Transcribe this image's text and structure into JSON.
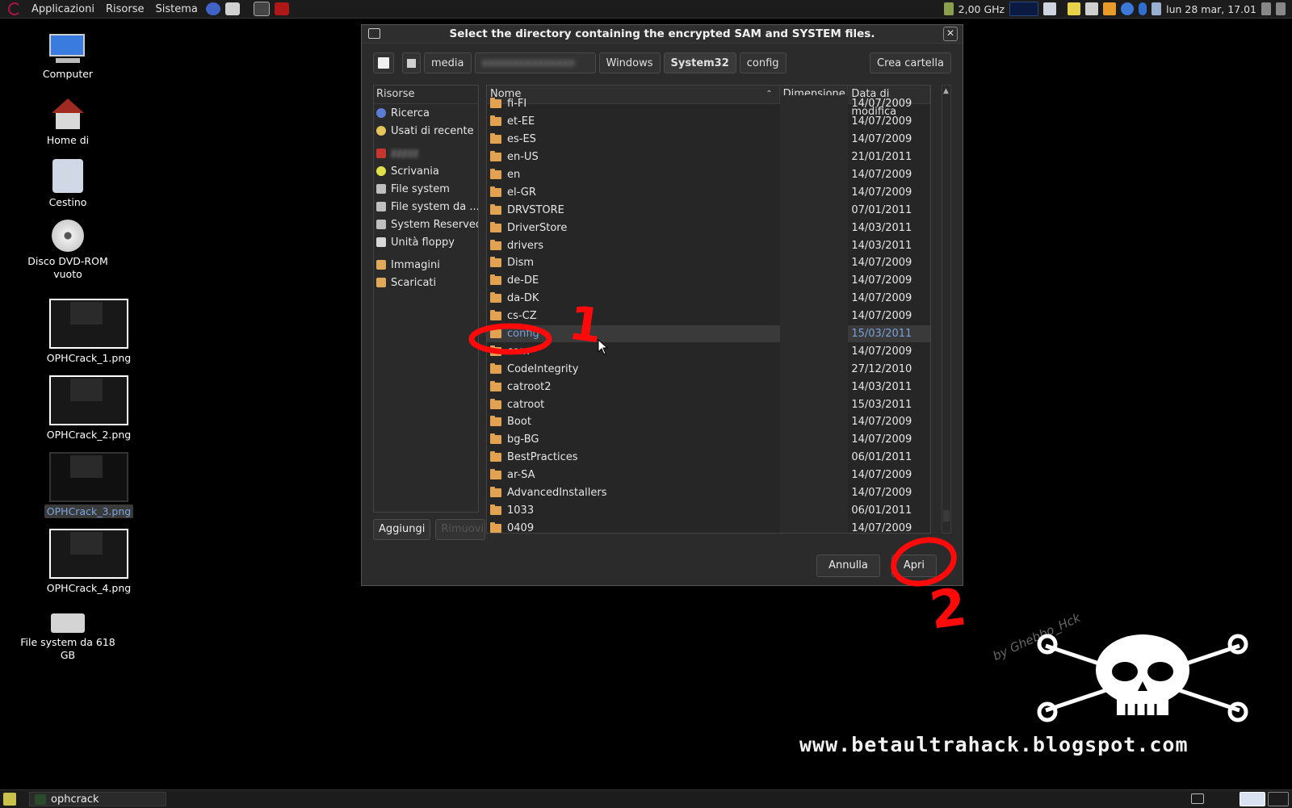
{
  "topbar": {
    "menus": [
      "Applicazioni",
      "Risorse",
      "Sistema"
    ],
    "cpu": "2,00 GHz",
    "clock": "lun 28 mar, 17.01"
  },
  "desktop": {
    "icons": [
      {
        "label": "Computer"
      },
      {
        "label": "Home di"
      },
      {
        "label": "Cestino"
      },
      {
        "label": "Disco DVD-ROM vuoto"
      },
      {
        "label": "OPHCrack_1.png"
      },
      {
        "label": "OPHCrack_2.png"
      },
      {
        "label": "OPHCrack_3.png"
      },
      {
        "label": "OPHCrack_4.png"
      },
      {
        "label": "File system da 618 GB"
      }
    ]
  },
  "dialog": {
    "title": "Select the directory containing the encrypted SAM and SYSTEM files.",
    "path": [
      "media",
      "Windows",
      "System32",
      "config"
    ],
    "create_folder": "Crea cartella",
    "places_header": "Risorse",
    "places": [
      "Ricerca",
      "Usati di recente",
      "Scrivania",
      "File system",
      "File system da ...",
      "System Reserved",
      "Unità floppy",
      "Immagini",
      "Scaricati"
    ],
    "add": "Aggiungi",
    "remove": "Rimuovi",
    "columns": {
      "name": "Nome",
      "size": "Dimensione",
      "date": "Data di modifica"
    },
    "files": [
      {
        "name": "fi-FI",
        "date": "14/07/2009"
      },
      {
        "name": "et-EE",
        "date": "14/07/2009"
      },
      {
        "name": "es-ES",
        "date": "14/07/2009"
      },
      {
        "name": "en-US",
        "date": "21/01/2011"
      },
      {
        "name": "en",
        "date": "14/07/2009"
      },
      {
        "name": "el-GR",
        "date": "14/07/2009"
      },
      {
        "name": "DRVSTORE",
        "date": "07/01/2011"
      },
      {
        "name": "DriverStore",
        "date": "14/03/2011"
      },
      {
        "name": "drivers",
        "date": "14/03/2011"
      },
      {
        "name": "Dism",
        "date": "14/07/2009"
      },
      {
        "name": "de-DE",
        "date": "14/07/2009"
      },
      {
        "name": "da-DK",
        "date": "14/07/2009"
      },
      {
        "name": "cs-CZ",
        "date": "14/07/2009"
      },
      {
        "name": "config",
        "date": "15/03/2011"
      },
      {
        "name": "com",
        "date": "14/07/2009"
      },
      {
        "name": "CodeIntegrity",
        "date": "27/12/2010"
      },
      {
        "name": "catroot2",
        "date": "14/03/2011"
      },
      {
        "name": "catroot",
        "date": "15/03/2011"
      },
      {
        "name": "Boot",
        "date": "14/07/2009"
      },
      {
        "name": "bg-BG",
        "date": "14/07/2009"
      },
      {
        "name": "BestPractices",
        "date": "06/01/2011"
      },
      {
        "name": "ar-SA",
        "date": "14/07/2009"
      },
      {
        "name": "AdvancedInstallers",
        "date": "14/07/2009"
      },
      {
        "name": "1033",
        "date": "06/01/2011"
      },
      {
        "name": "0409",
        "date": "14/07/2009"
      }
    ],
    "cancel": "Annulla",
    "open": "Apri"
  },
  "annotations": {
    "one": "1",
    "two": "2",
    "byline": "by Ghebbo_Hck"
  },
  "taskbar": {
    "task": "ophcrack"
  },
  "watermark": "www.betaultrahack.blogspot.com"
}
